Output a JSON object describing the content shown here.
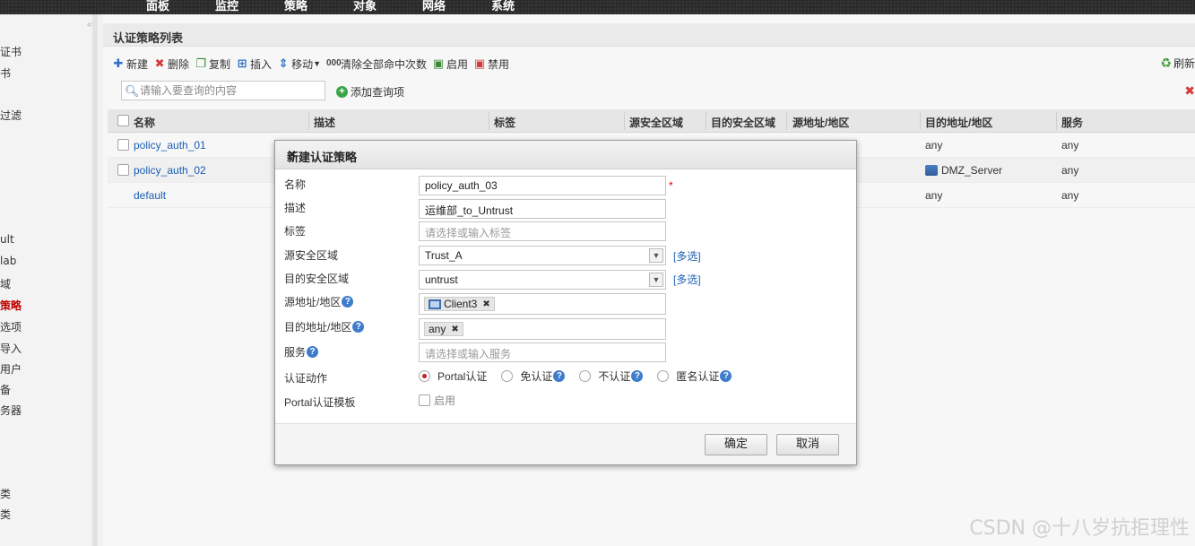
{
  "topnav": {
    "tabs": [
      "面板",
      "监控",
      "策略",
      "对象",
      "网络",
      "系统"
    ]
  },
  "sidebar": {
    "collapse_glyph": "«",
    "items": [
      "证书",
      "书",
      "过滤",
      "ult",
      "lab",
      "域",
      "策略",
      "选项",
      "导入",
      "用户",
      "备",
      "务器",
      "类",
      "类"
    ],
    "active_index": 6
  },
  "panel": {
    "title": "认证策略列表"
  },
  "toolbar": {
    "new": "新建",
    "delete": "删除",
    "copy": "复制",
    "insert": "插入",
    "move": "移动",
    "clear_hits": "清除全部命中次数",
    "enable": "启用",
    "disable": "禁用",
    "refresh": "刷新"
  },
  "search": {
    "placeholder": "请输入要查询的内容",
    "add_query": "添加查询项"
  },
  "table": {
    "headers": [
      "名称",
      "描述",
      "标签",
      "源安全区域",
      "目的安全区域",
      "源地址/地区",
      "目的地址/地区",
      "服务"
    ],
    "rows": [
      {
        "name": "policy_auth_01",
        "dst_addr": "any",
        "service": "any"
      },
      {
        "name": "policy_auth_02",
        "dst_addr": "DMZ_Server",
        "service": "any"
      },
      {
        "name": "default",
        "dst_addr": "any",
        "service": "any"
      }
    ]
  },
  "dialog": {
    "title": "新建认证策略",
    "close": "×",
    "labels": {
      "name": "名称",
      "desc": "描述",
      "tag": "标签",
      "src_zone": "源安全区域",
      "dst_zone": "目的安全区域",
      "src_addr": "源地址/地区",
      "dst_addr": "目的地址/地区",
      "service": "服务",
      "action": "认证动作",
      "portal_tpl": "Portal认证模板"
    },
    "values": {
      "name": "policy_auth_03",
      "desc": "运维部_to_Untrust",
      "tag_placeholder": "请选择或输入标签",
      "src_zone": "Trust_A",
      "dst_zone": "untrust",
      "src_addr_tag": "Client3",
      "dst_addr_tag": "any",
      "service_placeholder": "请选择或输入服务"
    },
    "required_mark": "*",
    "multi_select": "[多选]",
    "actions": {
      "portal": "Portal认证",
      "exempt": "免认证",
      "none": "不认证",
      "anonymous": "匿名认证"
    },
    "selected_action": "portal",
    "enable_label": "启用",
    "ok": "确定",
    "cancel": "取消"
  },
  "watermark": "CSDN @十八岁抗拒理性"
}
